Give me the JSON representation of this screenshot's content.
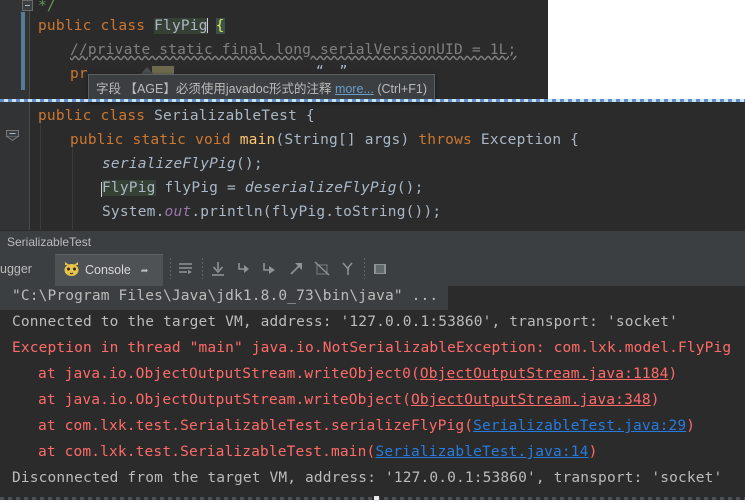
{
  "colors": {
    "editor_bg": "#2b2b2b",
    "gutter_bg": "#313335",
    "panel_bg": "#3c3f41",
    "text": "#a9b7c6",
    "keyword": "#cc7832",
    "method": "#ffc66d",
    "comment": "#808080",
    "error": "#ff6b68",
    "link": "#287bde",
    "selection_green": "#364135",
    "focus_border": "#5a8fc9"
  },
  "top_editor": {
    "line1": "*/",
    "line2": {
      "kw_public": "public",
      "kw_class": "class",
      "classname": "FlyPig",
      "brace": "{"
    },
    "line3": "//private static final long serialVersionUID = 1L;",
    "line4_partial": "pr"
  },
  "tooltip": {
    "text": "字段 【AGE】必须使用javadoc形式的注释 ",
    "more_link": "more...",
    "shortcut": "(Ctrl+F1)"
  },
  "main_editor": {
    "lines": [
      {
        "id": "class-decl",
        "indent": 0,
        "tokens": [
          {
            "t": "public",
            "c": "kw"
          },
          {
            "t": " ",
            "c": "plain"
          },
          {
            "t": "class",
            "c": "kw"
          },
          {
            "t": " SerializableTest {",
            "c": "plain"
          }
        ]
      },
      {
        "id": "main-decl",
        "indent": 1,
        "tokens": [
          {
            "t": "public",
            "c": "kw"
          },
          {
            "t": " ",
            "c": "plain"
          },
          {
            "t": "static",
            "c": "kw"
          },
          {
            "t": " ",
            "c": "plain"
          },
          {
            "t": "void",
            "c": "kw"
          },
          {
            "t": " ",
            "c": "plain"
          },
          {
            "t": "main",
            "c": "method"
          },
          {
            "t": "(String[] args) ",
            "c": "plain"
          },
          {
            "t": "throws",
            "c": "kw"
          },
          {
            "t": " Exception {",
            "c": "plain"
          }
        ]
      },
      {
        "id": "serialize-call",
        "indent": 2,
        "tokens": [
          {
            "t": "serializeFlyPig",
            "c": "ital"
          },
          {
            "t": "();",
            "c": "plain"
          }
        ]
      },
      {
        "id": "deserialize-call",
        "indent": 2,
        "tokens": [
          {
            "t": "FlyPig",
            "c": "sel-green"
          },
          {
            "t": " flyPig = ",
            "c": "plain"
          },
          {
            "t": "deserializeFlyPig",
            "c": "ital"
          },
          {
            "t": "();",
            "c": "plain"
          }
        ]
      },
      {
        "id": "println-call",
        "indent": 2,
        "tokens": [
          {
            "t": "System.",
            "c": "plain"
          },
          {
            "t": "out",
            "c": "static-field"
          },
          {
            "t": ".println(flyPig.toString());",
            "c": "plain"
          }
        ]
      }
    ]
  },
  "breadcrumb": {
    "label": "SerializableTest"
  },
  "debug_toolbar": {
    "left_tab_label": "ugger",
    "console_tab_label": "Console",
    "icons": [
      {
        "name": "cat-icon",
        "title": "Console"
      },
      {
        "name": "pin-icon",
        "title": "Pin Tab"
      },
      {
        "name": "soft-wrap-icon",
        "title": "Use Soft Wraps"
      },
      {
        "name": "scroll-to-end-icon",
        "title": "Scroll to End"
      },
      {
        "name": "step-down-icon",
        "title": "Down"
      },
      {
        "name": "step-down-2-icon",
        "title": "Down 2"
      },
      {
        "name": "step-up-icon",
        "title": "Up"
      },
      {
        "name": "clear-all-icon",
        "title": "Clear All"
      },
      {
        "name": "kill-process-icon",
        "title": "Stop"
      },
      {
        "name": "print-icon",
        "title": "Print"
      }
    ]
  },
  "console": {
    "lines": [
      {
        "id": "command-line",
        "highlight": true,
        "segments": [
          {
            "t": "\"C:\\Program Files\\Java\\jdk1.8.0_73\\bin\\java\" ...",
            "c": "c-info"
          }
        ]
      },
      {
        "id": "connected-line",
        "highlight": false,
        "segments": [
          {
            "t": "Connected to the target VM, address: '127.0.0.1:53860', transport: 'socket'",
            "c": "c-info"
          }
        ]
      },
      {
        "id": "exception-line",
        "highlight": false,
        "segments": [
          {
            "t": "Exception in thread \"main\" java.io.NotSerializableException: com.lxk.model.FlyPig",
            "c": "err"
          }
        ]
      },
      {
        "id": "stack-1",
        "highlight": false,
        "indent": true,
        "segments": [
          {
            "t": "at java.io.ObjectOutputStream.writeObject0(",
            "c": "err"
          },
          {
            "t": "ObjectOutputStream.java:1184",
            "c": "lnk-red"
          },
          {
            "t": ")",
            "c": "err"
          }
        ]
      },
      {
        "id": "stack-2",
        "highlight": false,
        "indent": true,
        "segments": [
          {
            "t": "at java.io.ObjectOutputStream.writeObject(",
            "c": "err"
          },
          {
            "t": "ObjectOutputStream.java:348",
            "c": "lnk-red"
          },
          {
            "t": ")",
            "c": "err"
          }
        ]
      },
      {
        "id": "stack-3",
        "highlight": false,
        "indent": true,
        "segments": [
          {
            "t": "at com.lxk.test.SerializableTest.serializeFlyPig(",
            "c": "err"
          },
          {
            "t": "SerializableTest.java:29",
            "c": "lnk"
          },
          {
            "t": ")",
            "c": "err"
          }
        ]
      },
      {
        "id": "stack-4",
        "highlight": false,
        "indent": true,
        "segments": [
          {
            "t": "at com.lxk.test.SerializableTest.main(",
            "c": "err"
          },
          {
            "t": "SerializableTest.java:14",
            "c": "lnk"
          },
          {
            "t": ")",
            "c": "err"
          }
        ]
      },
      {
        "id": "disconnected-line",
        "highlight": false,
        "segments": [
          {
            "t": "Disconnected from the target VM, address: '127.0.0.1:53860', transport: 'socket'",
            "c": "c-info"
          }
        ]
      }
    ]
  }
}
